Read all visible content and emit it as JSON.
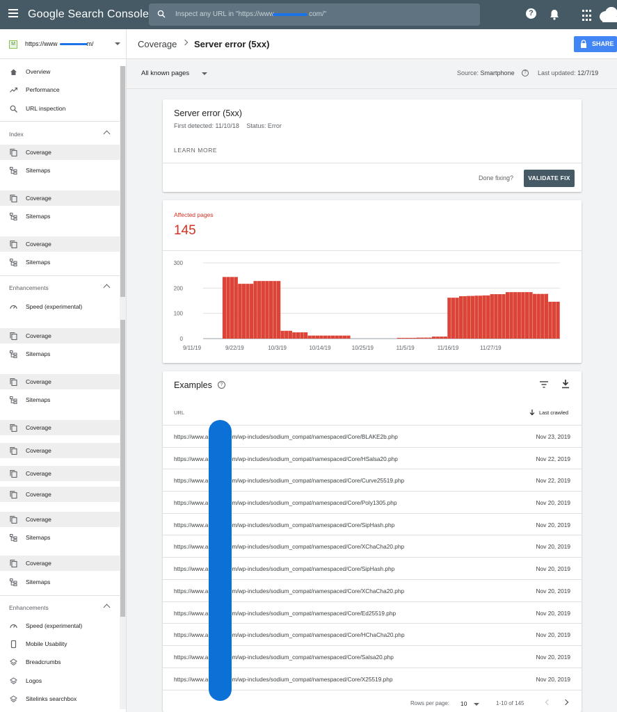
{
  "app": {
    "title": "Google Search Console",
    "search_placeholder_prefix": "Inspect any URL in \"https://www",
    "search_placeholder_suffix": "com/\"",
    "accent": "#455a64"
  },
  "sidebar": {
    "property": "https://www",
    "property_suffix": "m/",
    "property_fav": "M",
    "top_items": [
      {
        "label": "Overview",
        "icon": "home-icon"
      },
      {
        "label": "Performance",
        "icon": "trending-up-icon"
      },
      {
        "label": "URL inspection",
        "icon": "search-icon"
      }
    ],
    "index_title": "Index",
    "enh_title": "Enhancements",
    "coverage_label": "Coverage",
    "sitemaps_label": "Sitemaps",
    "speed_label": "Speed (experimental)",
    "enh_items": [
      {
        "label": "Speed (experimental)",
        "icon": "gauge-icon"
      },
      {
        "label": "Mobile Usability",
        "icon": "phone-icon"
      },
      {
        "label": "Breadcrumbs",
        "icon": "layers-icon"
      },
      {
        "label": "Logos",
        "icon": "layers-icon"
      },
      {
        "label": "Sitelinks searchbox",
        "icon": "layers-icon"
      }
    ]
  },
  "header": {
    "crumb": "Coverage",
    "title": "Server error (5xx)",
    "share": "SHARE"
  },
  "filterbar": {
    "selection": "All known pages",
    "source_label": "Source:",
    "source_value": "Smartphone",
    "updated_label": "Last updated:",
    "updated_value": "12/7/19"
  },
  "issue": {
    "title": "Server error (5xx)",
    "first_detected": "First detected: 11/10/18",
    "status": "Status: Error",
    "learn_more": "LEARN MORE",
    "done_fixing": "Done fixing?",
    "validate": "VALIDATE FIX"
  },
  "affected": {
    "label": "Affected pages",
    "value": "145"
  },
  "chart_data": {
    "type": "bar",
    "ylim": [
      0,
      300
    ],
    "yticks": [
      0,
      100,
      200,
      300
    ],
    "xticks": [
      "9/11/19",
      "9/22/19",
      "10/3/19",
      "10/14/19",
      "10/25/19",
      "11/5/19",
      "11/16/19",
      "11/27/19"
    ],
    "xtick_index": [
      0,
      11,
      22,
      33,
      44,
      55,
      66,
      77
    ],
    "color": "#db4437",
    "values": [
      0,
      0,
      0,
      0,
      0,
      244,
      244,
      244,
      244,
      217,
      217,
      217,
      217,
      228,
      228,
      228,
      228,
      228,
      228,
      228,
      31,
      31,
      31,
      25,
      25,
      25,
      25,
      12,
      12,
      12,
      12,
      12,
      12,
      12,
      12,
      12,
      12,
      12,
      0,
      0,
      0,
      0,
      0,
      0,
      0,
      0,
      0,
      0,
      0,
      0,
      3,
      3,
      3,
      3,
      3,
      4,
      4,
      4,
      4,
      8,
      8,
      8,
      8,
      162,
      162,
      162,
      168,
      168,
      169,
      169,
      170,
      170,
      171,
      171,
      176,
      176,
      176,
      176,
      184,
      184,
      184,
      184,
      184,
      184,
      184,
      177,
      177,
      177,
      177,
      146,
      146,
      146
    ]
  },
  "examples": {
    "title": "Examples",
    "col_url": "URL",
    "col_crawled": "Last crawled",
    "rows": [
      {
        "url": "https://www.a          .com/wp-includes/sodium_compat/namespaced/Core/BLAKE2b.php",
        "date": "Nov 23, 2019"
      },
      {
        "url": "https://www.a          .com/wp-includes/sodium_compat/namespaced/Core/HSalsa20.php",
        "date": "Nov 22, 2019"
      },
      {
        "url": "https://www.a          .com/wp-includes/sodium_compat/namespaced/Core/Curve25519.php",
        "date": "Nov 22, 2019"
      },
      {
        "url": "https://www.a          .com/wp-includes/sodium_compat/namespaced/Core/Poly1305.php",
        "date": "Nov 20, 2019"
      },
      {
        "url": "https://www.a          .com/wp-includes/sodium_compat/namespaced/Core/SipHash.php",
        "date": "Nov 20, 2019"
      },
      {
        "url": "https://www.a          .com/wp-includes/sodium_compat/namespaced/Core/XChaCha20.php",
        "date": "Nov 20, 2019"
      },
      {
        "url": "https://www.a          .com/wp-includes/sodium_compat/namespaced/Core/SipHash.php",
        "date": "Nov 20, 2019"
      },
      {
        "url": "https://www.a          .com/wp-includes/sodium_compat/namespaced/Core/XChaCha20.php",
        "date": "Nov 20, 2019"
      },
      {
        "url": "https://www.a          .com/wp-includes/sodium_compat/namespaced/Core/Ed25519.php",
        "date": "Nov 20, 2019"
      },
      {
        "url": "https://www.a          .com/wp-includes/sodium_compat/namespaced/Core/HChaCha20.php",
        "date": "Nov 20, 2019"
      },
      {
        "url": "https://www.a          .com/wp-includes/sodium_compat/namespaced/Core/Salsa20.php",
        "date": "Nov 20, 2019"
      },
      {
        "url": "https://www.a          .com/wp-includes/sodium_compat/namespaced/Core/X25519.php",
        "date": "Nov 20, 2019"
      }
    ],
    "rows_per_page_label": "Rows per page:",
    "rows_per_page": "10",
    "range": "1-10 of 145"
  }
}
